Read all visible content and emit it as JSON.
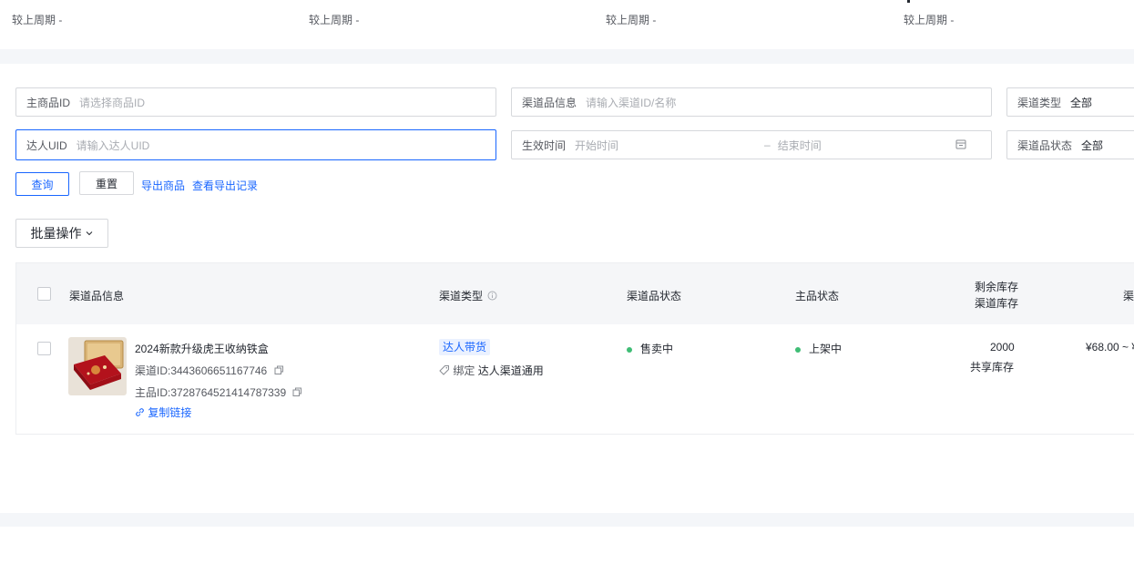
{
  "stats": {
    "compare_label": [
      "较上周期 -",
      "较上周期 -",
      "较上周期 -",
      "较上周期 -"
    ]
  },
  "filters": {
    "main_product_id": {
      "label": "主商品ID",
      "placeholder": "请选择商品ID"
    },
    "channel_product_info": {
      "label": "渠道品信息",
      "placeholder": "请输入渠道ID/名称"
    },
    "channel_type": {
      "label": "渠道类型",
      "value": "全部"
    },
    "talent_uid": {
      "label": "达人UID",
      "placeholder": "请输入达人UID"
    },
    "effective_time": {
      "label": "生效时间",
      "start_placeholder": "开始时间",
      "separator": "–",
      "end_placeholder": "结束时间"
    },
    "channel_status": {
      "label": "渠道品状态",
      "value": "全部"
    }
  },
  "actions": {
    "query": "查询",
    "reset": "重置",
    "export_products": "导出商品",
    "view_export_records": "查看导出记录",
    "batch_ops": "批量操作"
  },
  "table": {
    "headers": {
      "channel_info": "渠道品信息",
      "channel_type": "渠道类型",
      "channel_status": "渠道品状态",
      "main_status": "主品状态",
      "remaining_stock": "剩余库存",
      "channel_stock": "渠道库存",
      "price_partial": "渠"
    },
    "rows": [
      {
        "title": "2024新款升级虎王收纳铁盒",
        "channel_id": "渠道ID:3443606651167746",
        "main_id": "主品ID:3728764521414787339",
        "copy_link": "复制链接",
        "type_tag": "达人带货",
        "bind_label": "绑定",
        "bind_value": "达人渠道通用",
        "channel_status": "售卖中",
        "main_status": "上架中",
        "stock": "2000",
        "stock_note": "共享库存",
        "price": "¥68.00 ~ ¥"
      }
    ]
  },
  "colors": {
    "accent": "#1966ff",
    "status_green": "#3fbd75",
    "band": "#f4f6f9"
  }
}
